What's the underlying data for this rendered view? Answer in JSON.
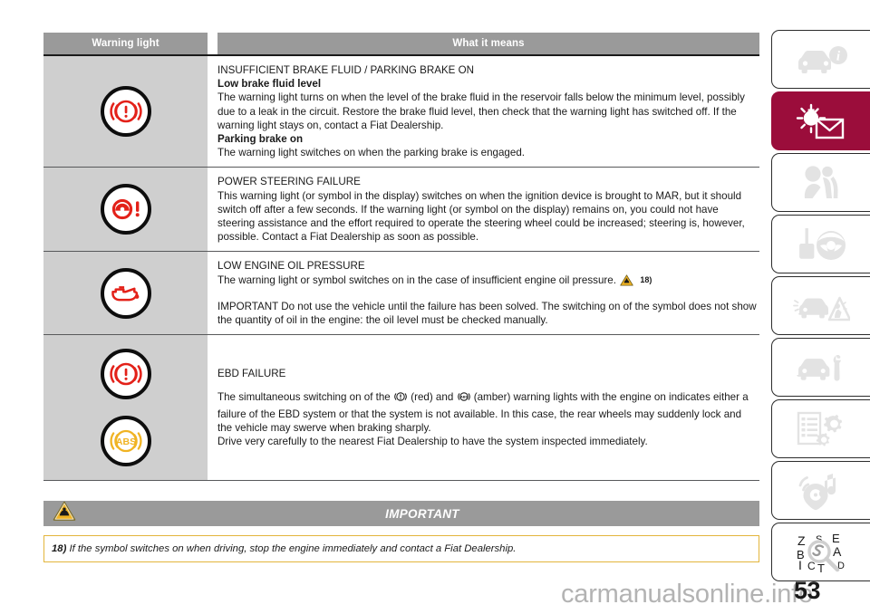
{
  "document": {
    "page_number": "53",
    "watermark": "carmanualsonline.info"
  },
  "table": {
    "headers": {
      "symbol_column": "Warning light",
      "meaning_column": "What it means"
    },
    "rows": [
      {
        "symbol_name": "brake-warning-light",
        "symbols": [
          "brake-exclamation-red"
        ],
        "title": "INSUFFICIENT BRAKE FLUID / PARKING BRAKE ON",
        "subhead_1": "Low brake fluid level",
        "body_1": "The warning light turns on when the level of the brake fluid in the reservoir falls below the minimum level, possibly due to a leak in the circuit. Restore the brake fluid level, then check that the warning light has switched off. If the warning light stays on, contact a Fiat Dealership.",
        "subhead_2": "Parking brake on",
        "body_2": "The warning light switches on when the parking brake is engaged."
      },
      {
        "symbol_name": "power-steering-failure-light",
        "symbols": [
          "steering-wheel-exclamation-red"
        ],
        "title": "POWER STEERING FAILURE",
        "body_1": "This warning light (or symbol in the display) switches on when the ignition device is brought to MAR, but it should switch off after a few seconds. If the warning light (or symbol on the display) remains on, you could not have steering assistance and the effort required to operate the steering wheel could be increased; steering is, however, possible. Contact a Fiat Dealership as soon as possible."
      },
      {
        "symbol_name": "low-engine-oil-pressure-light",
        "symbols": [
          "oil-can-red"
        ],
        "title": "LOW ENGINE OIL PRESSURE",
        "body_1_a": "The warning light or symbol switches on in the case of insufficient engine oil pressure.",
        "body_1_ref": "18)",
        "body_2": "IMPORTANT Do not use the vehicle until the failure has been solved. The switching on of the symbol does not show the quantity of oil in the engine: the oil level must be checked manually."
      },
      {
        "symbol_name": "ebd-failure-lights",
        "symbols": [
          "brake-exclamation-red",
          "abs-amber"
        ],
        "title": "EBD FAILURE",
        "body_1_a": "The simultaneous switching on of the",
        "body_1_b": "(red) and",
        "body_1_c": "(amber) warning lights with the engine on indicates either a failure of the EBD system or that the system is not available. In this case, the rear wheels may suddenly lock and the vehicle may swerve when braking sharply.",
        "body_2": "Drive very carefully to the nearest Fiat Dealership to have the system inspected immediately."
      }
    ]
  },
  "important_section": {
    "icon": "warning-triangle-icon",
    "label": "IMPORTANT",
    "note_ref": "18)",
    "note_text": "If the symbol switches on when driving, stop the engine immediately and contact a Fiat Dealership."
  },
  "sidebar": {
    "active_index": 1,
    "tabs": [
      {
        "name": "tab-dashboard-info",
        "icon": "car-info-icon"
      },
      {
        "name": "tab-warning-lights-messages",
        "icon": "warning-light-envelope-icon"
      },
      {
        "name": "tab-safety",
        "icon": "seatbelt-passenger-icon"
      },
      {
        "name": "tab-starting-driving",
        "icon": "key-steering-wheel-icon"
      },
      {
        "name": "tab-emergency",
        "icon": "car-breakdown-triangle-icon"
      },
      {
        "name": "tab-maintenance-care",
        "icon": "car-wrench-icon"
      },
      {
        "name": "tab-technical-specifications",
        "icon": "list-gears-icon"
      },
      {
        "name": "tab-multimedia",
        "icon": "music-signal-icon"
      },
      {
        "name": "tab-alphabetical-index",
        "icon": "index-magnifier-icon"
      }
    ]
  },
  "colors": {
    "accent": "#9b0d3b",
    "header_gray": "#9a9a9a",
    "symbol_cell_gray": "#cfcfcf",
    "warning_red": "#e32119",
    "amber": "#f0b323",
    "note_border": "#e3b53c"
  }
}
